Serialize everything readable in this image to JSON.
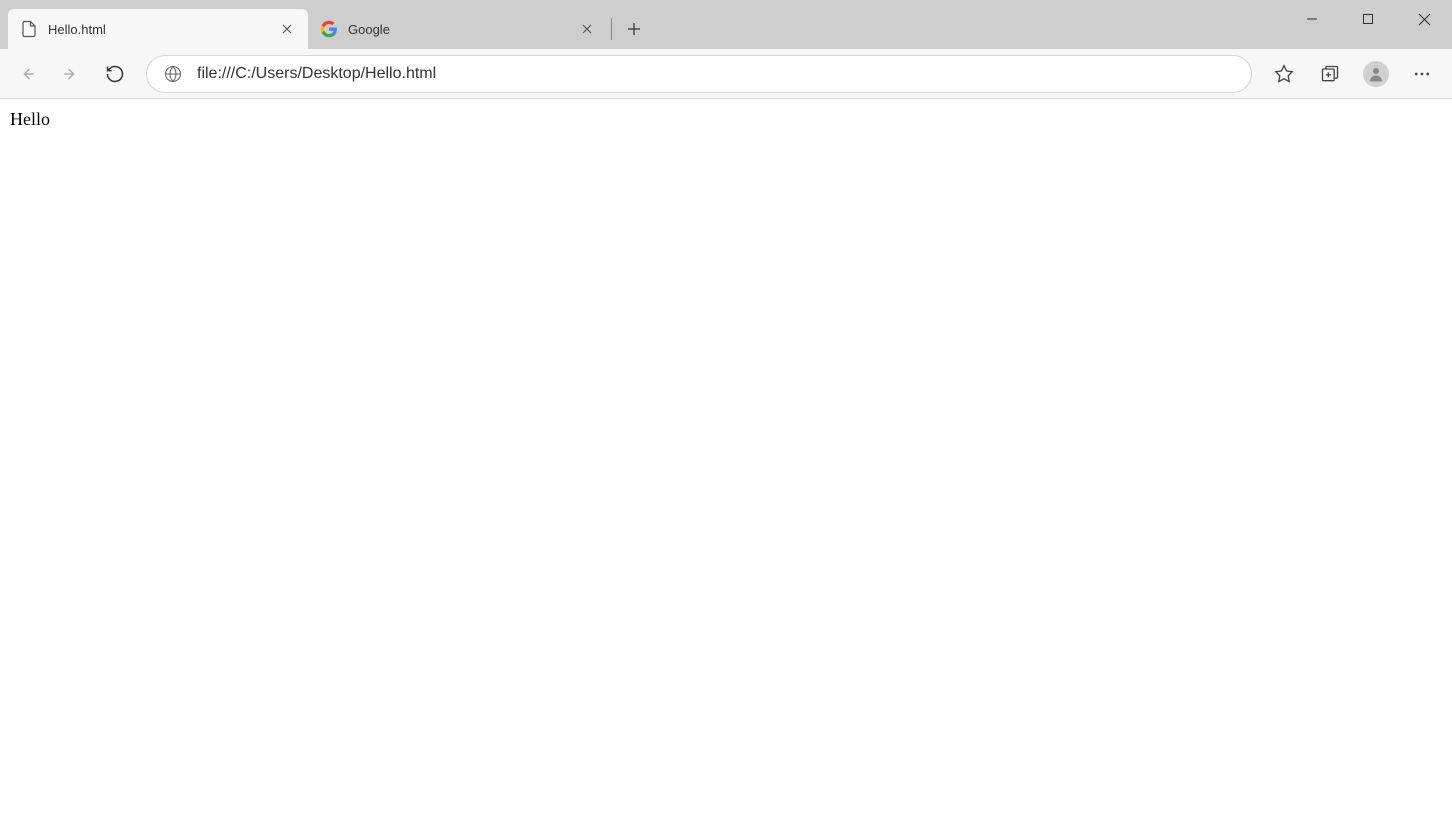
{
  "tabs": [
    {
      "title": "Hello.html",
      "active": true
    },
    {
      "title": "Google",
      "active": false
    }
  ],
  "address_bar": {
    "url": "file:///C:/Users/Desktop/Hello.html"
  },
  "page_content": {
    "body_text": "Hello"
  }
}
